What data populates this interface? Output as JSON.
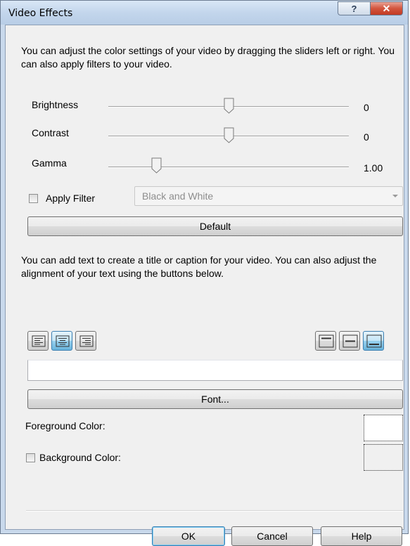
{
  "window": {
    "title": "Video Effects",
    "help_glyph": "?",
    "close_glyph": "✕"
  },
  "intro_text": "You can adjust the color settings of your video by dragging the sliders left or right. You can also apply filters to your video.",
  "sliders": [
    {
      "label": "Brightness",
      "value": "0",
      "position": 0.5
    },
    {
      "label": "Contrast",
      "value": "0",
      "position": 0.5
    },
    {
      "label": "Gamma",
      "value": "1.00",
      "position": 0.2
    }
  ],
  "filter": {
    "checkbox_label": "Apply Filter",
    "checked": false,
    "selected": "Black and White"
  },
  "default_button": "Default",
  "text_intro": "You can add text to create a title or caption for your video. You can also adjust the alignment of your text using the buttons below.",
  "alignment": {
    "horizontal": [
      "align-left",
      "align-center",
      "align-right"
    ],
    "horizontal_selected": "align-center",
    "vertical": [
      "align-top",
      "align-middle",
      "align-bottom"
    ],
    "vertical_selected": "align-bottom"
  },
  "caption_value": "",
  "font_button": "Font...",
  "foreground_label": "Foreground Color:",
  "background_label": "Background Color:",
  "background_checked": false,
  "buttons": {
    "ok": "OK",
    "cancel": "Cancel",
    "help": "Help"
  }
}
